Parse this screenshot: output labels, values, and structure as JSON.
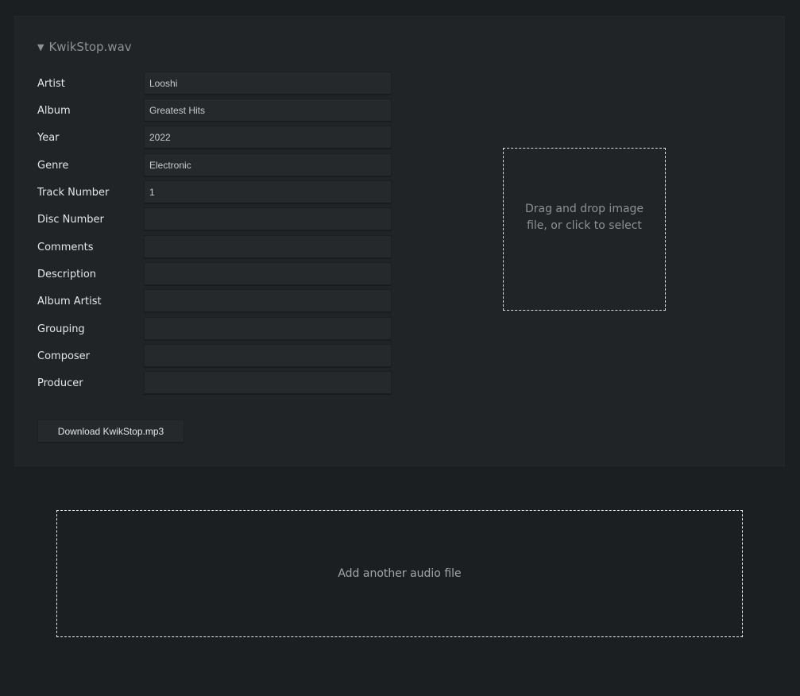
{
  "file": {
    "toggle_icon": "triangle-down-icon",
    "name": "KwikStop.wav"
  },
  "fields": [
    {
      "label": "Artist",
      "value": "Looshi"
    },
    {
      "label": "Album",
      "value": "Greatest Hits"
    },
    {
      "label": "Year",
      "value": "2022"
    },
    {
      "label": "Genre",
      "value": "Electronic"
    },
    {
      "label": "Track Number",
      "value": "1"
    },
    {
      "label": "Disc Number",
      "value": ""
    },
    {
      "label": "Comments",
      "value": ""
    },
    {
      "label": "Description",
      "value": ""
    },
    {
      "label": "Album Artist",
      "value": ""
    },
    {
      "label": "Grouping",
      "value": ""
    },
    {
      "label": "Composer",
      "value": ""
    },
    {
      "label": "Producer",
      "value": ""
    }
  ],
  "download": {
    "label": "Download KwikStop.mp3"
  },
  "image_drop": {
    "text": "Drag and drop image file, or click to select"
  },
  "audio_drop": {
    "text": "Add another audio file"
  }
}
